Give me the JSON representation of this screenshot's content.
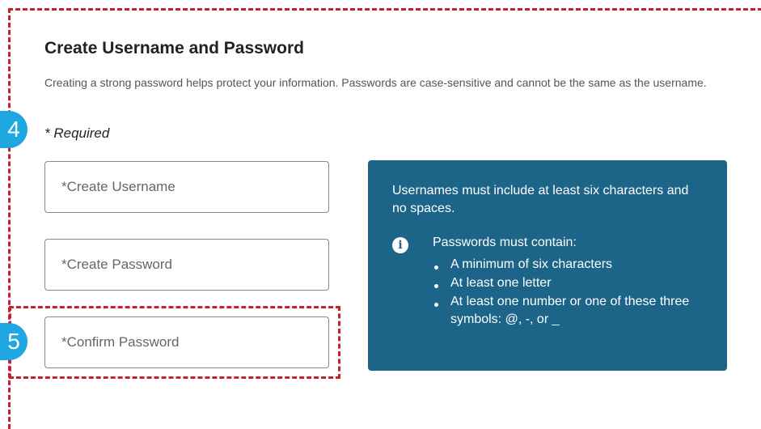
{
  "form": {
    "title": "Create Username and Password",
    "description": "Creating a strong password helps protect your information. Passwords are case-sensitive and cannot be the same as the username.",
    "required_note": "* Required",
    "username_placeholder": "*Create Username",
    "password_placeholder": "*Create Password",
    "confirm_placeholder": "*Confirm Password"
  },
  "annotations": {
    "step_4": "4",
    "step_5": "5",
    "badge_color": "#1ea7e1",
    "frame_color": "#c8202e"
  },
  "info_panel": {
    "background": "#1c6589",
    "username_rule": "Usernames must include at least six characters and no spaces.",
    "icon": "info-icon",
    "password_heading": "Passwords must contain:",
    "password_rules": [
      "A minimum of six characters",
      "At least one letter",
      "At least one number or one of these three symbols: @, -, or _"
    ]
  }
}
